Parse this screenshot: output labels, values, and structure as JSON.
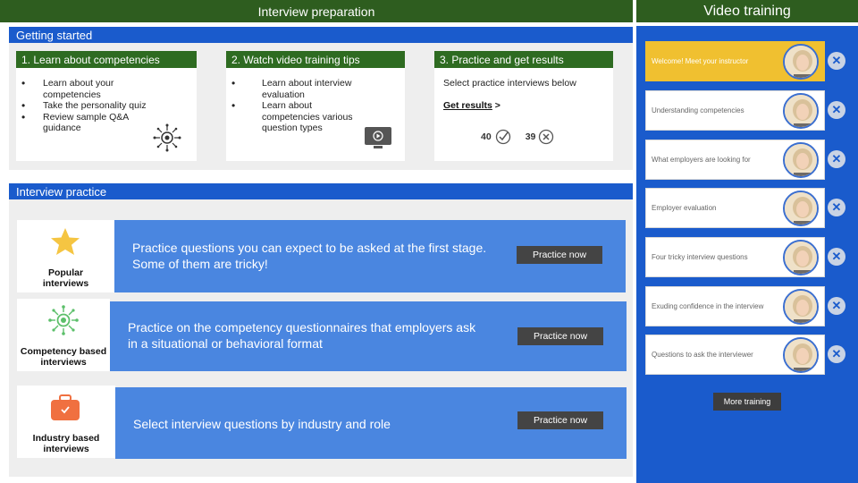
{
  "header": {
    "title": "Interview preparation"
  },
  "getting_started": {
    "title": "Getting started",
    "steps": [
      {
        "title": "1. Learn about competencies",
        "items": [
          "Learn about your competencies",
          "Take the personality quiz",
          "Review sample Q&A guidance"
        ]
      },
      {
        "title": "2. Watch video training tips",
        "items": [
          "Learn about interview evaluation",
          "Learn about competencies various question types"
        ]
      },
      {
        "title": "3. Practice and get results",
        "text": "Select practice interviews below",
        "link": "Get results",
        "link_suffix": " >",
        "passed": "40",
        "failed": "39"
      }
    ]
  },
  "interview_practice": {
    "title": "Interview practice",
    "rows": [
      {
        "label": "Popular interviews",
        "text": "Practice questions you can expect to be asked at the first stage.  Some of them are tricky!",
        "button": "Practice now",
        "icon": "star-icon"
      },
      {
        "label": "Competency based interviews",
        "text": "Practice on the competency questionnaires that employers ask in a situational or behavioral format",
        "button": "Practice now",
        "icon": "competency-icon"
      },
      {
        "label": "Industry based interviews",
        "text": "Select interview questions by industry and role",
        "button": "Practice now",
        "icon": "briefcase-icon"
      }
    ]
  },
  "video_training": {
    "title": "Video training",
    "items": [
      {
        "label": "Welcome! Meet your instructor",
        "active": true
      },
      {
        "label": "Understanding competencies"
      },
      {
        "label": "What employers are looking for"
      },
      {
        "label": "Employer evaluation"
      },
      {
        "label": "Four tricky interview questions"
      },
      {
        "label": "Exuding confidence in the interview"
      },
      {
        "label": "Questions to ask the interviewer"
      }
    ],
    "more_button": "More training"
  },
  "colors": {
    "green": "#2e5d1f",
    "blue": "#1a5bcc",
    "light_blue": "#4a86e0",
    "gold": "#f0c030",
    "star": "#f5c542",
    "competency": "#5cbf6a",
    "briefcase": "#f07040"
  }
}
